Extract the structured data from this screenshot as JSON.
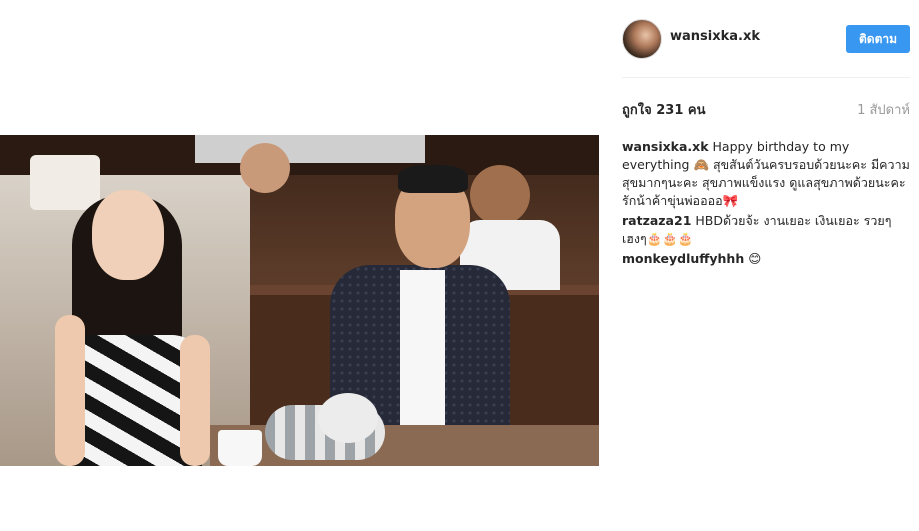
{
  "post": {
    "username": "wansixka.xk",
    "follow_label": "ติดตาม",
    "likes_text": "ถูกใจ 231 คน",
    "time_text": "1 สัปดาห์"
  },
  "comments": [
    {
      "user": "wansixka.xk",
      "text": "Happy birthday to my everything 🙈 สุขสันต์วันครบรอบด้วยนะคะ มีความสุขมากๆนะคะ สุขภาพแข็งแรง ดูแลสุขภาพด้วยนะคะ รักน้าค้าขุ่นพ่ออออ🎀"
    },
    {
      "user": "ratzaza21",
      "text": "HBDด้วยจ้ะ งานเยอะ เงินเยอะ รวยๆเฮงๆ🎂🎂🎂"
    },
    {
      "user": "monkeydluffyhhh",
      "text": "😊"
    }
  ],
  "colors": {
    "follow_button": "#3897f0",
    "text": "#262626",
    "muted": "#999999"
  }
}
